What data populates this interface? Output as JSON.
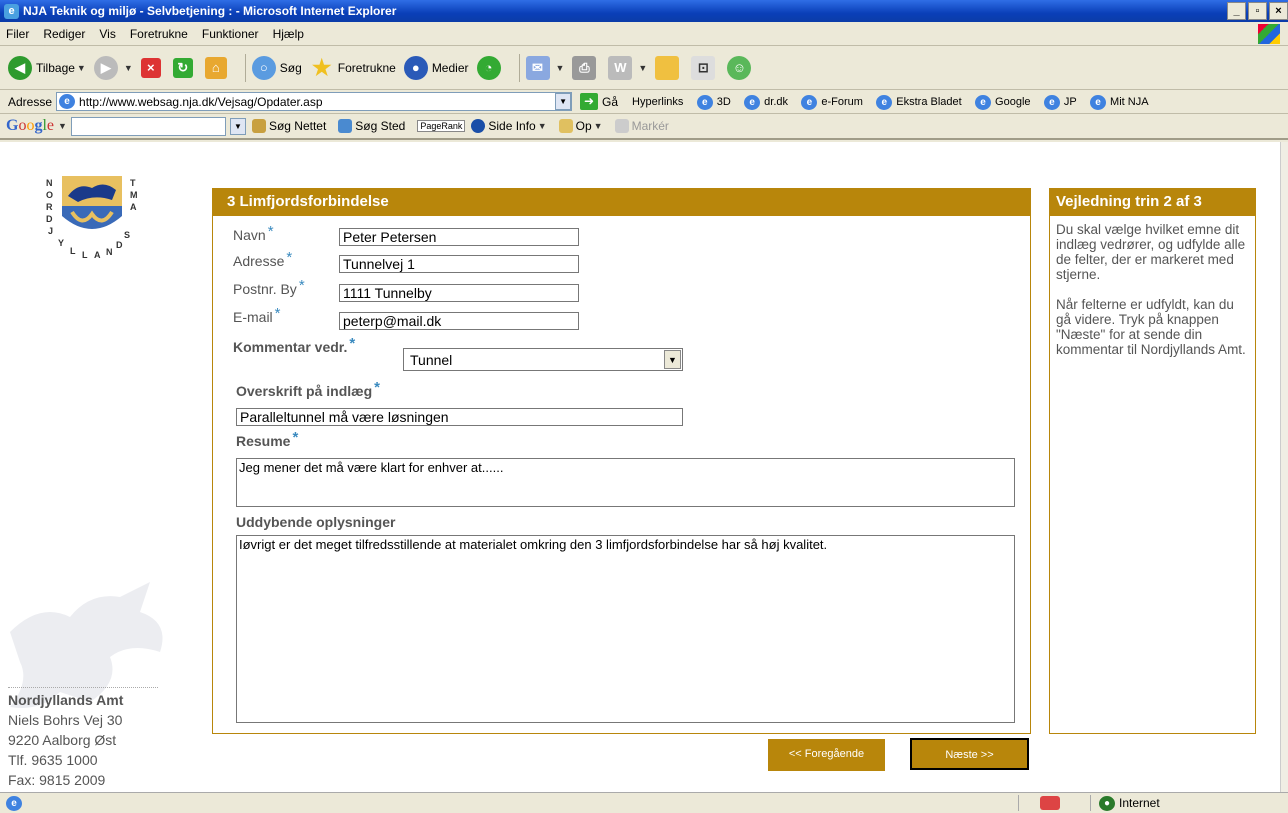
{
  "window": {
    "title": "NJA Teknik og miljø - Selvbetjening : - Microsoft Internet Explorer"
  },
  "menu": [
    "Filer",
    "Rediger",
    "Vis",
    "Foretrukne",
    "Funktioner",
    "Hjælp"
  ],
  "toolbar": {
    "back": "Tilbage",
    "search": "Søg",
    "favorites": "Foretrukne",
    "media": "Medier"
  },
  "addressbar": {
    "label": "Adresse",
    "url": "http://www.websag.nja.dk/Vejsag/Opdater.asp",
    "go": "Gå",
    "links_label": "Hyperlinks",
    "links": [
      "3D",
      "dr.dk",
      "e-Forum",
      "Ekstra Bladet",
      "Google",
      "JP",
      "Mit NJA"
    ]
  },
  "googlebar": {
    "search_web": "Søg Nettet",
    "search_site": "Søg Sted",
    "pagerank": "PageRank",
    "page_info": "Side Info",
    "up": "Op",
    "highlight": "Markér"
  },
  "page": {
    "logo_text": "NORDJYLLANDS AMT",
    "org": {
      "name": "Nordjyllands Amt",
      "street": "Niels Bohrs Vej 30",
      "city": "9220 Aalborg Øst",
      "phone": "Tlf. 9635 1000",
      "fax": "Fax: 9815 2009"
    },
    "form": {
      "heading": "3 Limfjordsforbindelse",
      "name_label": "Navn",
      "name_value": "Peter Petersen",
      "address_label": "Adresse",
      "address_value": "Tunnelvej 1",
      "zip_label": "Postnr. By",
      "zip_value": "1111 Tunnelby",
      "email_label": "E-mail",
      "email_value": "peterp@mail.dk",
      "comment_label": "Kommentar vedr.",
      "comment_value": "Tunnel",
      "headline_label": "Overskrift på indlæg",
      "headline_value": "Paralleltunnel må være løsningen",
      "summary_label": "Resume",
      "summary_value": "Jeg mener det må være klart for enhver at......",
      "details_label": "Uddybende oplysninger",
      "details_value": "Iøvrigt er det meget tilfredsstillende at materialet omkring den 3 limfjordsforbindelse har så høj kvalitet.",
      "star": "*",
      "prev_button": "<< Foregående",
      "next_button": "Næste >>"
    },
    "guide": {
      "heading": "Vejledning trin 2 af 3",
      "p1": "Du skal vælge hvilket emne dit indlæg vedrører, og udfylde alle de felter, der er markeret med stjerne.",
      "p2": "Når felterne er udfyldt, kan du gå videre. Tryk på knappen \"Næste\" for at sende din kommentar til Nordjyllands Amt."
    }
  },
  "status": {
    "zone": "Internet"
  },
  "colors": {
    "accent": "#b8860b",
    "star": "#3a8abf"
  }
}
